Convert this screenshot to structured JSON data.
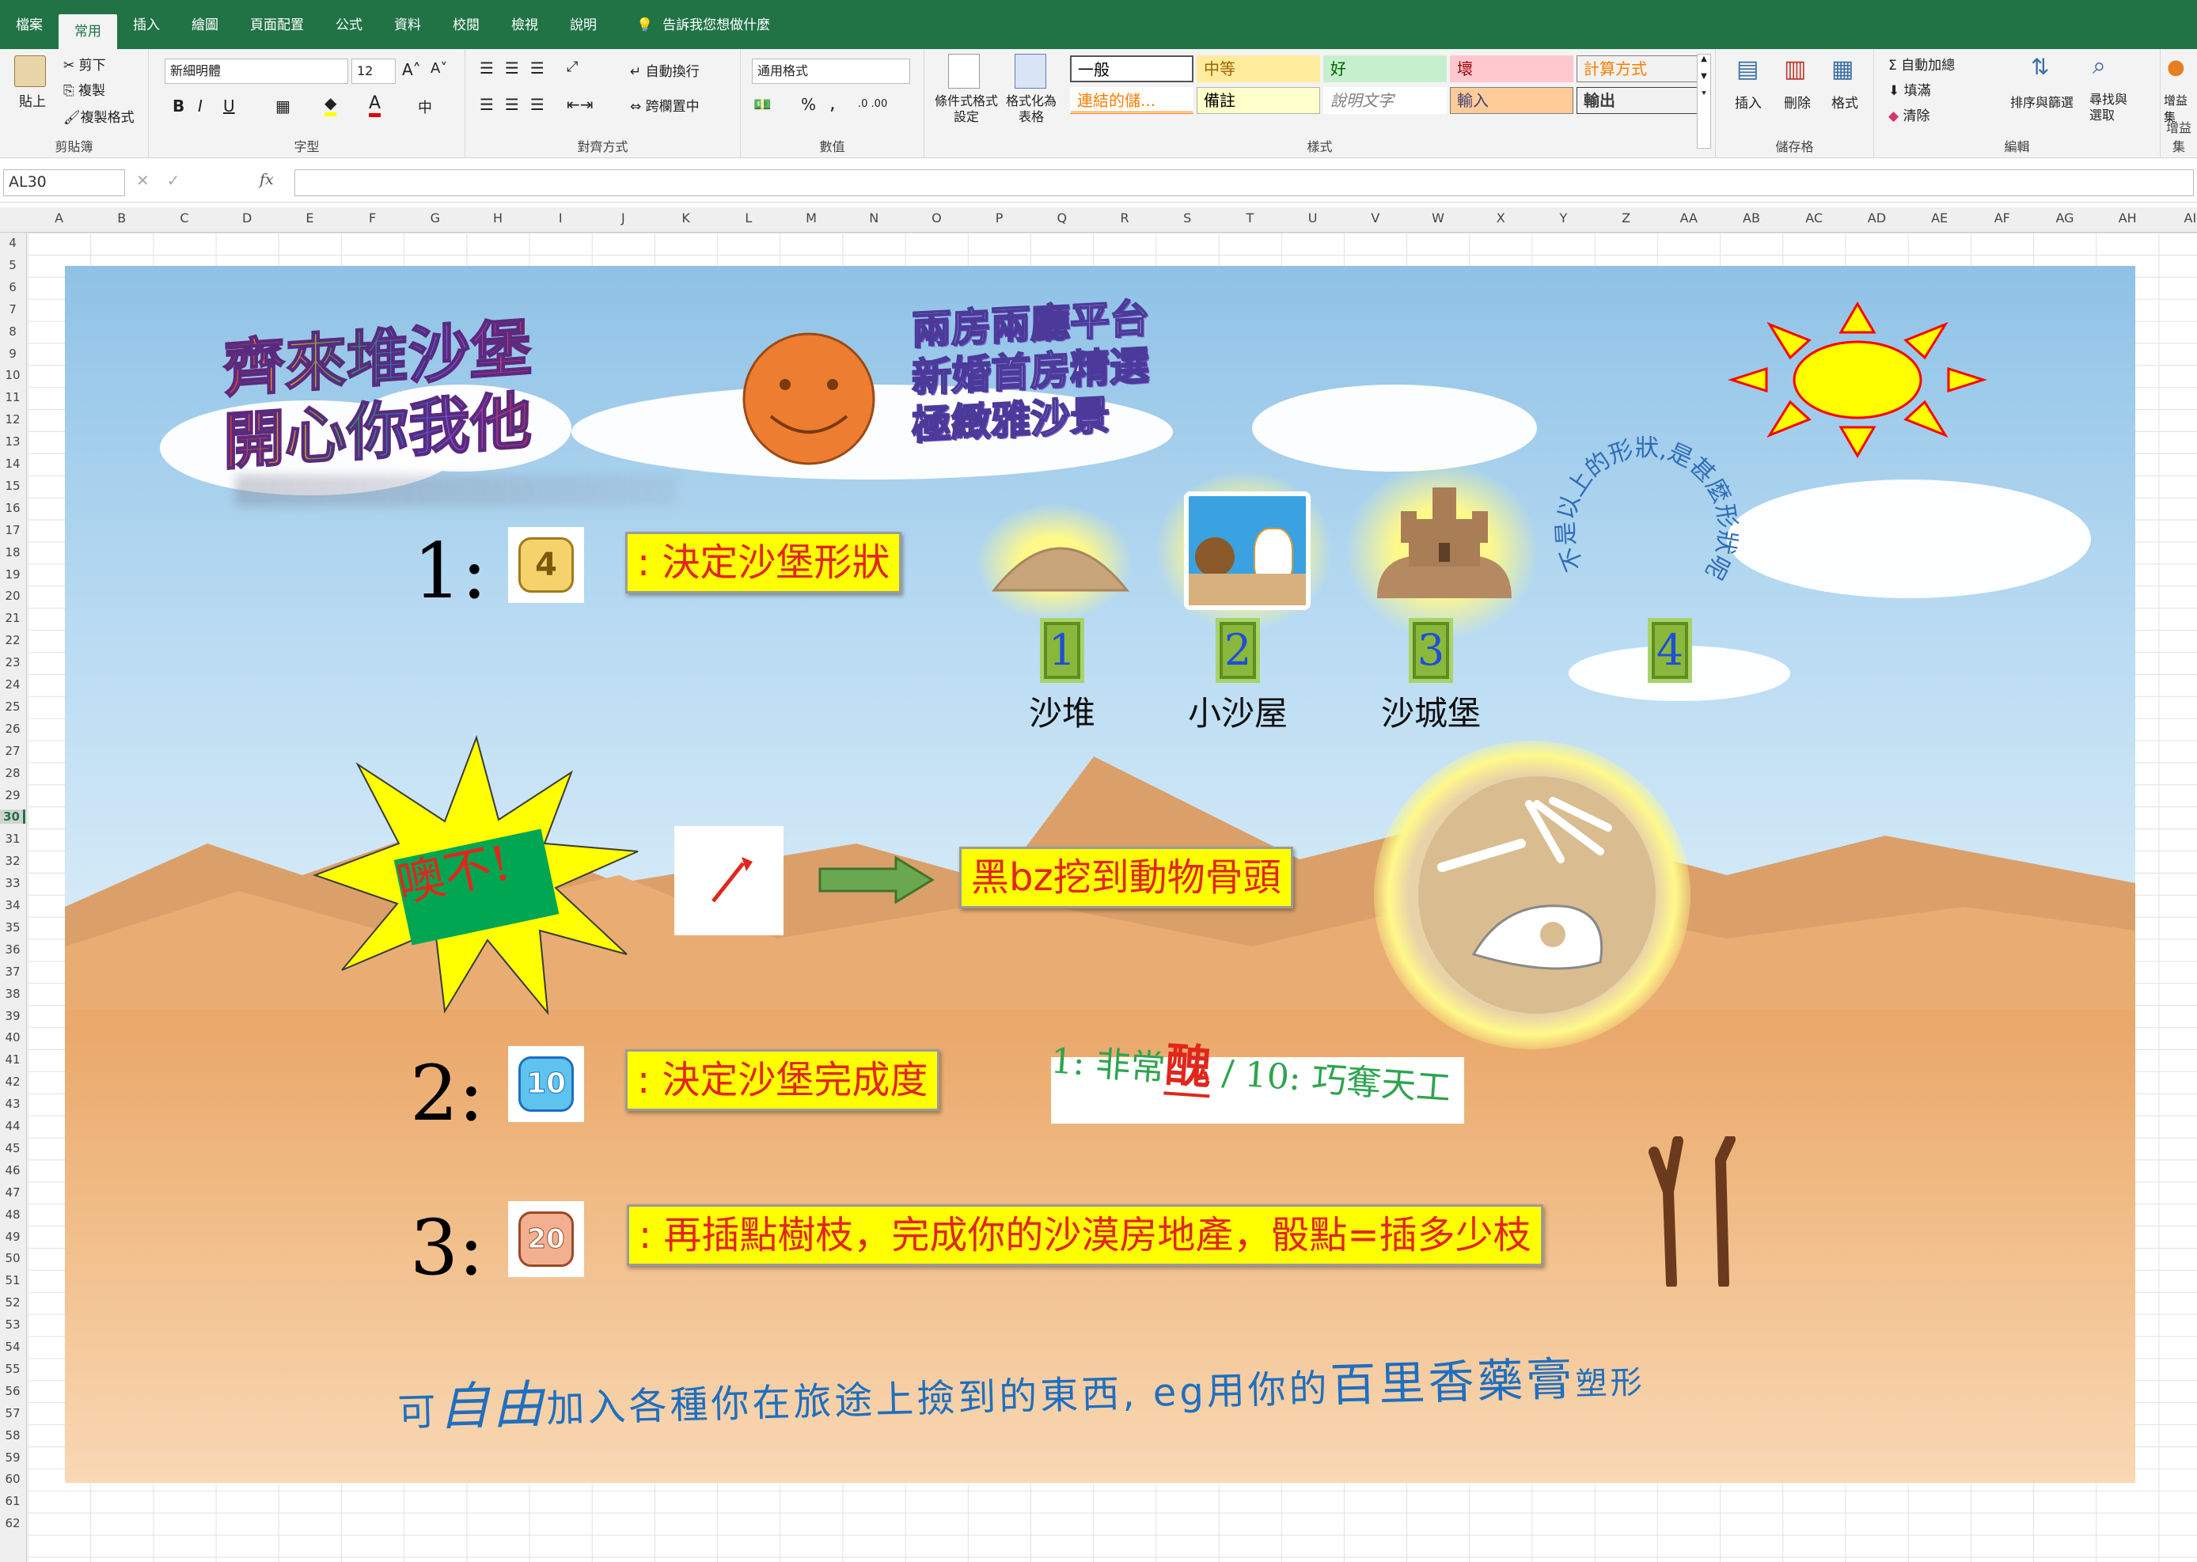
{
  "menu": {
    "tabs": [
      "檔案",
      "常用",
      "插入",
      "繪圖",
      "頁面配置",
      "公式",
      "資料",
      "校閱",
      "檢視",
      "說明"
    ],
    "active_index": 1,
    "tellme": "告訴我您想做什麼"
  },
  "ribbon": {
    "clipboard": {
      "paste": "貼上",
      "cut": "剪下",
      "copy": "複製",
      "format_painter": "複製格式",
      "label": "剪貼簿"
    },
    "font": {
      "name": "新細明體",
      "size": "12",
      "label": "字型",
      "bold": "B",
      "italic": "I",
      "underline": "U"
    },
    "alignment": {
      "wrap": "自動換行",
      "merge": "跨欄置中",
      "label": "對齊方式"
    },
    "number": {
      "format": "通用格式",
      "percent": "%",
      "comma": ",",
      "label": "數值"
    },
    "styles": {
      "conditional": "條件式格式設定",
      "as_table": "格式化為表格",
      "label": "樣式",
      "cells": [
        "一般",
        "中等",
        "好",
        "壞",
        "計算方式",
        "連結的儲...",
        "備註",
        "說明文字",
        "輸入",
        "輸出"
      ]
    },
    "cells": {
      "insert": "插入",
      "delete": "刪除",
      "format": "格式",
      "label": "儲存格"
    },
    "editing": {
      "autosum": "自動加總",
      "fill": "填滿",
      "clear": "清除",
      "sort": "排序與篩選",
      "find": "尋找與選取",
      "label": "編輯"
    },
    "addin": {
      "label": "增益集",
      "btn": "增益集"
    }
  },
  "formula": {
    "namebox": "AL30",
    "fx": "fx",
    "value": ""
  },
  "columns": [
    "A",
    "B",
    "C",
    "D",
    "E",
    "F",
    "G",
    "H",
    "I",
    "J",
    "K",
    "L",
    "M",
    "N",
    "O",
    "P",
    "Q",
    "R",
    "S",
    "T",
    "U",
    "V",
    "W",
    "X",
    "Y",
    "Z",
    "AA",
    "AB",
    "AC",
    "AD",
    "AE",
    "AF",
    "AG",
    "AH",
    "AI"
  ],
  "rows": [
    "4",
    "5",
    "6",
    "7",
    "8",
    "9",
    "10",
    "11",
    "12",
    "13",
    "14",
    "15",
    "16",
    "17",
    "18",
    "19",
    "20",
    "21",
    "22",
    "23",
    "24",
    "25",
    "26",
    "27",
    "28",
    "29",
    "30",
    "31",
    "32",
    "33",
    "34",
    "35",
    "36",
    "37",
    "38",
    "39",
    "40",
    "41",
    "42",
    "43",
    "44",
    "45",
    "46",
    "47",
    "48",
    "49",
    "50",
    "51",
    "52",
    "53",
    "54",
    "55",
    "56",
    "57",
    "58",
    "59",
    "60",
    "61",
    "62"
  ],
  "sheet": {
    "title_line1": "齊來堆沙堡",
    "title_line2": "開心你我他",
    "promo_line1": "兩房兩廳平台",
    "promo_line2": "新婚首房精選",
    "promo_line3": "極緻雅沙景",
    "arc_text": "不是以上的形狀,是甚麼形狀呢?",
    "step1_num": "1:",
    "step1_icon": "4",
    "step1_text": ": 決定沙堡形狀",
    "shapes": [
      {
        "badge": "1",
        "label": "沙堆"
      },
      {
        "badge": "2",
        "label": "小沙屋"
      },
      {
        "badge": "3",
        "label": "沙城堡"
      },
      {
        "badge": "4",
        "label": ""
      }
    ],
    "oops": "噢不!",
    "bone_text": "黑bz挖到動物骨頭",
    "step2_num": "2:",
    "step2_icon": "10",
    "step2_text": ": 決定沙堡完成度",
    "scale_a": "1: 非常",
    "scale_ugly": "醜",
    "scale_b": " / 10: 巧奪天工",
    "step3_num": "3:",
    "step3_icon": "20",
    "step3_text": ": 再插點樹枝，完成你的沙漠房地產，骰點=插多少枝",
    "footer": {
      "p1": "可",
      "p2": "自由",
      "p3": "加入各種你在旅途上撿到的東西, eg用你的",
      "p4": "百里香藥膏",
      "p5": "塑形"
    }
  },
  "colors": {
    "excel_green": "#217346",
    "title_box": "#ffff00",
    "title_text": "#e1261c",
    "footer_blue": "#1f6fbf",
    "scale_green": "#2ea44f"
  }
}
